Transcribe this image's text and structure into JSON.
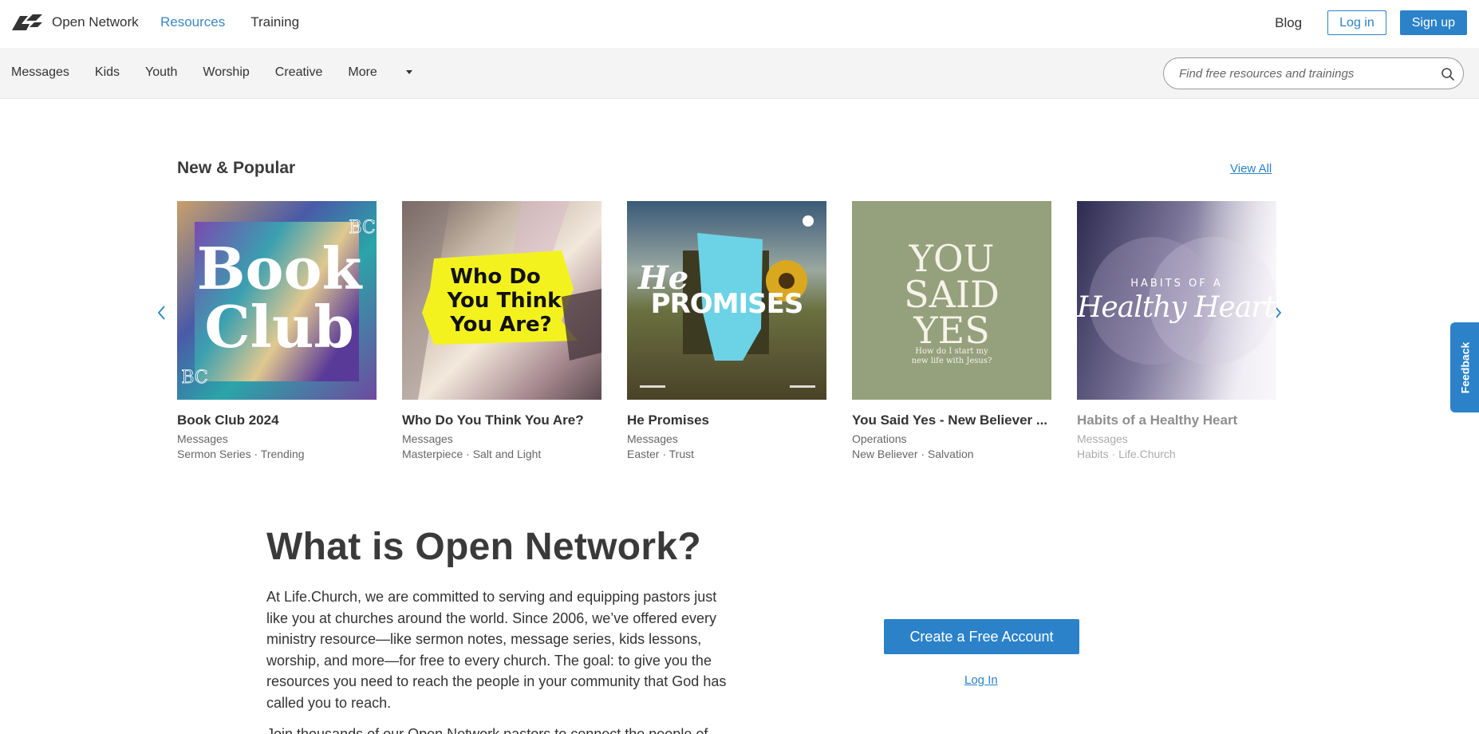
{
  "header": {
    "logo_text": "Open Network",
    "nav": [
      "Resources",
      "Training"
    ],
    "blog": "Blog",
    "login": "Log in",
    "signup": "Sign up"
  },
  "subnav": {
    "items": [
      "Messages",
      "Kids",
      "Youth",
      "Worship",
      "Creative",
      "More"
    ],
    "search_placeholder": "Find free resources and trainings"
  },
  "section": {
    "title": "New & Popular",
    "view_all": "View All"
  },
  "cards": [
    {
      "title": "Book Club 2024",
      "category": "Messages",
      "tags": "Sermon Series · Trending",
      "art_text": [
        "Book",
        "Club"
      ],
      "corner_text": "BC"
    },
    {
      "title": "Who Do You Think You Are?",
      "category": "Messages",
      "tags": "Masterpiece · Salt and Light",
      "art_text": [
        "Who Do",
        "You Think",
        "You Are?"
      ]
    },
    {
      "title": "He Promises",
      "category": "Messages",
      "tags": "Easter · Trust",
      "art_text": [
        "He",
        "PROMISES"
      ]
    },
    {
      "title": "You Said Yes - New Believer ...",
      "category": "Operations",
      "tags": "New Believer · Salvation",
      "art_text": [
        "YOU",
        "SAID",
        "YES"
      ],
      "art_sub": [
        "How do I start my",
        "new life with Jesus?"
      ]
    },
    {
      "title": "Habits of a Healthy Heart",
      "category": "Messages",
      "tags": "Habits · Life.Church",
      "art_text": [
        "HABITS OF A",
        "Healthy Heart"
      ]
    }
  ],
  "about": {
    "title": "What is Open Network?",
    "body": "At Life.Church, we are committed to serving and equipping pastors just like you at churches around the world. Since 2006, we’ve offered every ministry resource—like sermon notes, message series, kids lessons, worship, and more—for free to every church. The goal: to give you the resources you need to reach the people in your community that God has called you to reach.",
    "more": "Join thousands of our Open Network pastors to connect the people of",
    "cta": "Create a Free Account",
    "login_link": "Log In"
  },
  "feedback": "Feedback",
  "colors": {
    "accent": "#2b82c9",
    "subnav_bg": "#f4f4f4"
  }
}
